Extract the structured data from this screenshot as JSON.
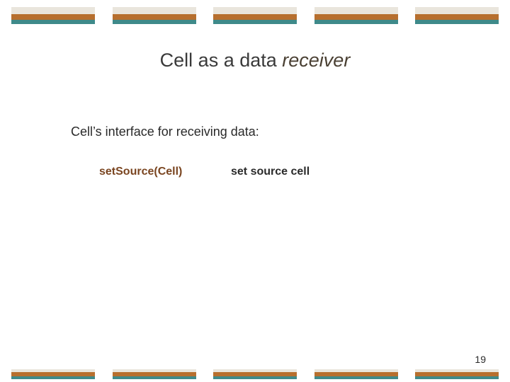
{
  "title_plain": "Cell as a data ",
  "title_accent": "receiver",
  "subhead": "Cell’s interface for receiving data:",
  "method": "setSource(Cell)",
  "desc": "set source cell",
  "page_number": "19"
}
